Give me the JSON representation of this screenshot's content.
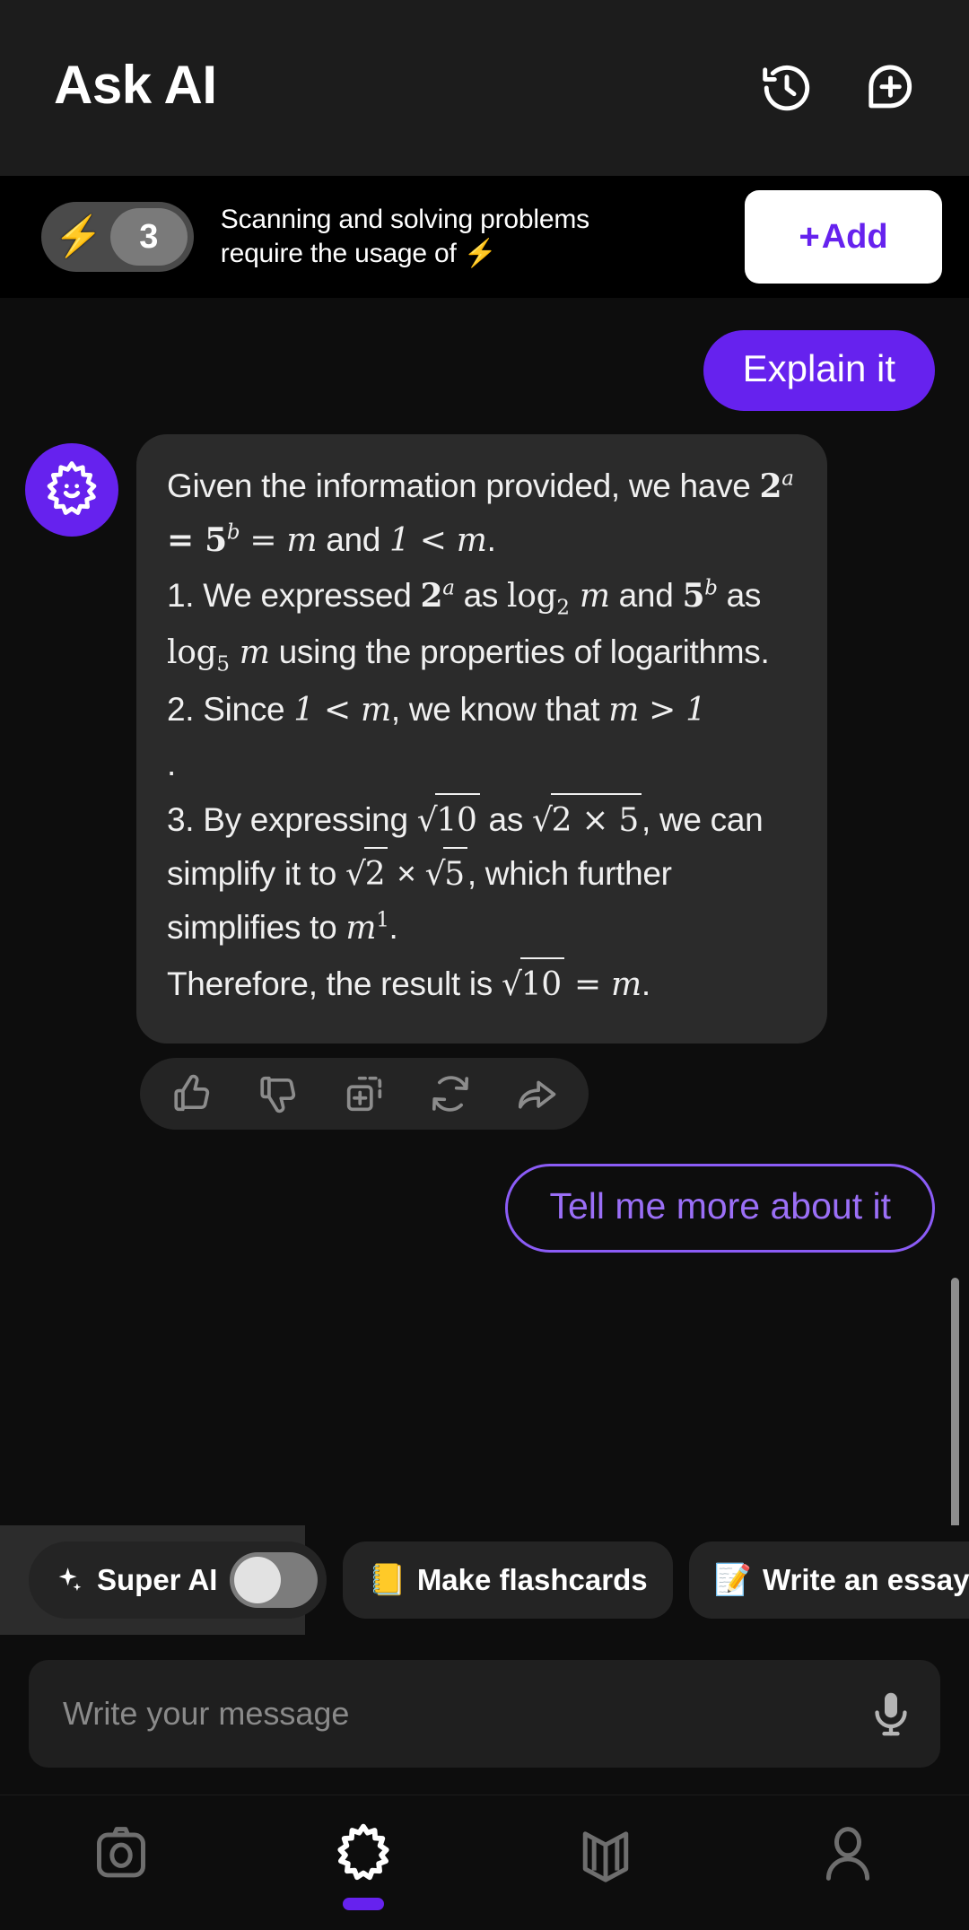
{
  "colors": {
    "accent_purple": "#6622ee",
    "suggest_border": "#8b5cf6",
    "bolt_yellow": "#f5c518",
    "bg": "#0d0d0d",
    "header_bg": "#1c1c1c",
    "bubble_ai_bg": "#2b2b2b"
  },
  "header": {
    "title": "Ask AI",
    "history_icon": "history-clock-icon",
    "new_chat_icon": "new-chat-plus-icon"
  },
  "credits": {
    "bolt_icon": "⚡",
    "count": "3",
    "message": "Scanning and solving problems require the usage of ⚡",
    "message_line1": "Scanning and solving problems",
    "message_line2": "require the usage of ⚡",
    "add_label": "Add",
    "add_plus": "+"
  },
  "chat": {
    "user_message": "Explain it",
    "avatar_icon": "ai-starburst-face-icon",
    "ai_message": {
      "intro_text_1": "Given the information provided, we have ",
      "intro_math_1": "2",
      "intro_sup_1": "a",
      "intro_math_2": " = 5",
      "intro_sup_2": "b",
      "intro_math_3": " = m",
      "intro_text_2": " and ",
      "intro_math_4": "1 < m",
      "intro_text_3": ".",
      "step1_num": "1. ",
      "step1_a": "We expressed ",
      "step1_m1": "2",
      "step1_s1": "a",
      "step1_b": " as ",
      "step1_m2": "log",
      "step1_sub2": "2",
      "step1_m2b": " m",
      "step1_c": " and ",
      "step1_m3": "5",
      "step1_s3": "b",
      "step1_d": " as ",
      "step1_m4": "log",
      "step1_sub4": "5",
      "step1_m4b": " m",
      "step1_e": " using the properties of logarithms.",
      "step2_num": "2. ",
      "step2_a": "Since ",
      "step2_m1": "1 < m",
      "step2_b": ", we know that ",
      "step2_m2": "m > 1",
      "step2_c": ".",
      "step3_num": "3. ",
      "step3_a": "By expressing ",
      "step3_r1": "10",
      "step3_b": " as ",
      "step3_r2": "2 × 5",
      "step3_c": ", we can simplify it to ",
      "step3_r3": "2",
      "step3_d": " × ",
      "step3_r4": "5",
      "step3_e": ", which further simplifies to ",
      "step3_m1": "m",
      "step3_s1": "1",
      "step3_f": ".",
      "concl_a": "Therefore, the result is ",
      "concl_r": "10",
      "concl_b": " = m",
      "concl_c": "."
    },
    "actions": [
      {
        "name": "thumbs-up-icon",
        "label": "Like"
      },
      {
        "name": "thumbs-down-icon",
        "label": "Dislike"
      },
      {
        "name": "add-to-collection-icon",
        "label": "Save"
      },
      {
        "name": "regenerate-icon",
        "label": "Regenerate"
      },
      {
        "name": "share-icon",
        "label": "Share"
      }
    ],
    "suggestion": "Tell me more about it"
  },
  "chips": {
    "super_ai": {
      "label": "Super AI",
      "enabled": false,
      "icon": "sparkle-icon"
    },
    "items": [
      {
        "emoji": "📒",
        "label": "Make flashcards"
      },
      {
        "emoji": "📝",
        "label": "Write an essay"
      }
    ]
  },
  "input": {
    "placeholder": "Write your message",
    "value": "",
    "mic_icon": "microphone-icon"
  },
  "bottom_nav": {
    "items": [
      {
        "name": "camera-icon",
        "label": "Scan",
        "active": false
      },
      {
        "name": "ai-starburst-icon",
        "label": "Ask AI",
        "active": true
      },
      {
        "name": "book-icon",
        "label": "Library",
        "active": false
      },
      {
        "name": "profile-icon",
        "label": "Profile",
        "active": false
      }
    ]
  }
}
